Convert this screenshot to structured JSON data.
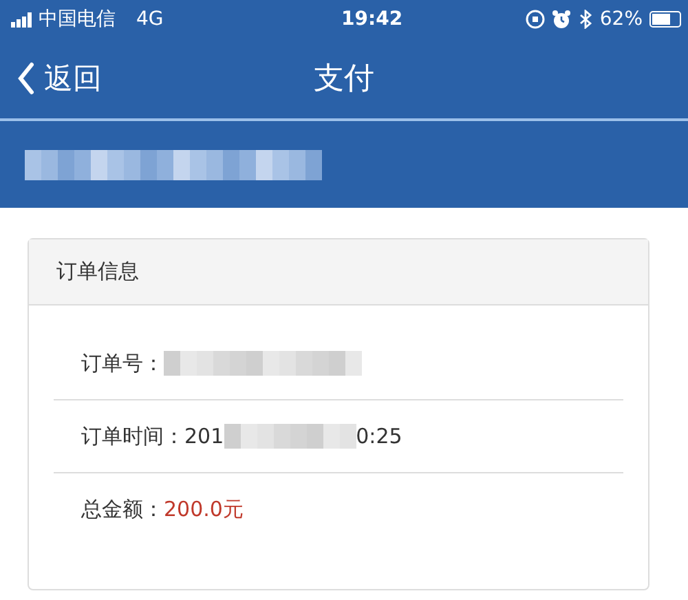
{
  "status_bar": {
    "carrier": "中国电信",
    "network": "4G",
    "time": "19:42",
    "battery": "62%"
  },
  "nav_bar": {
    "back": "返回",
    "title": "支付"
  },
  "banner": {
    "redacted": true
  },
  "order_card": {
    "title": "订单信息",
    "rows": [
      {
        "label": "订单号：",
        "redacted": true
      },
      {
        "label": "订单时间：",
        "before": "201",
        "redacted": true,
        "after": "0:25",
        "emphasis": false
      },
      {
        "label": "总金额：",
        "before": "200.0元",
        "redacted": false,
        "emphasis": true
      }
    ]
  }
}
